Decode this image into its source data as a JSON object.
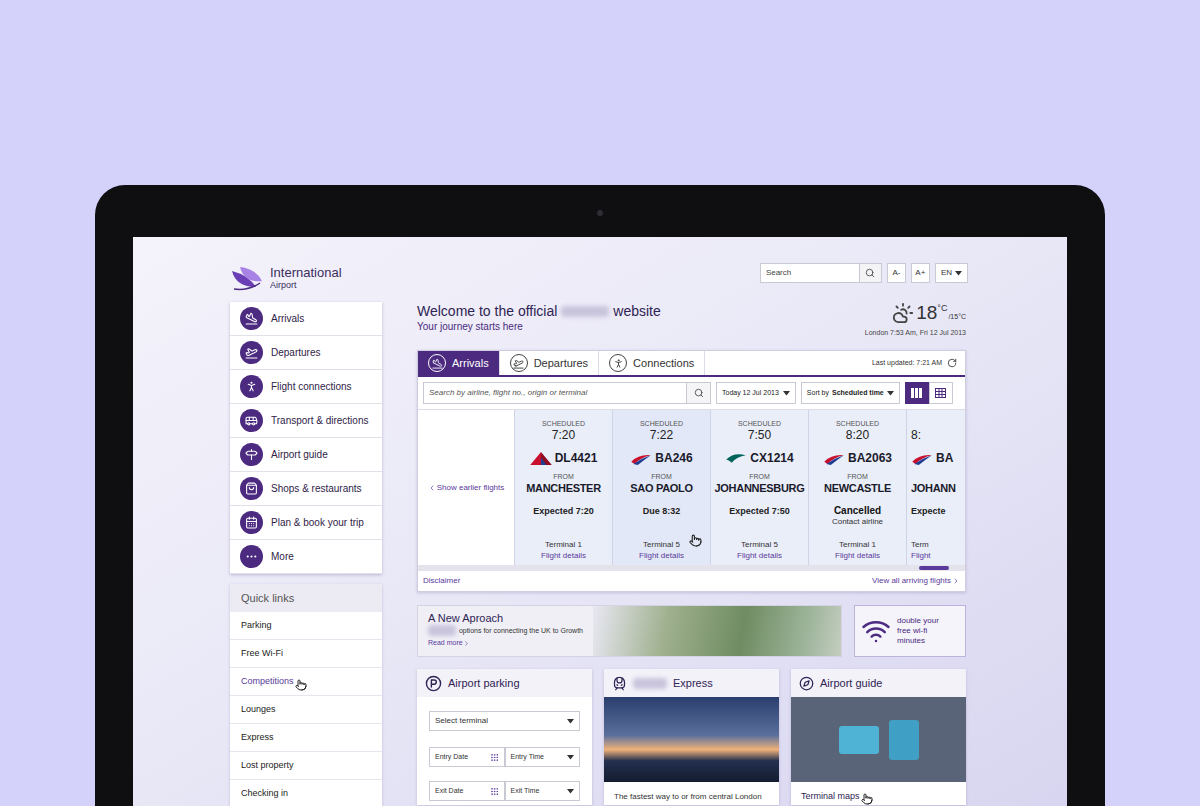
{
  "header": {
    "logo": {
      "title": "International",
      "subtitle": "Airport"
    },
    "search": {
      "placeholder": "Search"
    },
    "text_size_buttons": [
      "A-",
      "A+"
    ],
    "language": "EN"
  },
  "sidebar": {
    "items": [
      {
        "label": "Arrivals"
      },
      {
        "label": "Departures"
      },
      {
        "label": "Flight connections"
      },
      {
        "label": "Transport & directions"
      },
      {
        "label": "Airport guide"
      },
      {
        "label": "Shops & restaurants"
      },
      {
        "label": "Plan & book your trip"
      },
      {
        "label": "More"
      }
    ],
    "quick_links": {
      "title": "Quick links",
      "items": [
        {
          "label": "Parking",
          "hovered": false
        },
        {
          "label": "Free Wi-Fi",
          "hovered": false
        },
        {
          "label": "Competitions",
          "hovered": true
        },
        {
          "label": "Lounges",
          "hovered": false
        },
        {
          "label": "Express",
          "hovered": false
        },
        {
          "label": "Lost property",
          "hovered": false
        },
        {
          "label": "Checking in",
          "hovered": false
        }
      ]
    }
  },
  "welcome": {
    "before": "Welcome to the official",
    "after": "website",
    "tagline": "Your journey starts here"
  },
  "weather": {
    "temperature": "18",
    "unit": "°C",
    "low": "/15°C",
    "place_time": "London 7:53 Am, Fri 12 Jul 2013"
  },
  "flights": {
    "tabs": [
      {
        "label": "Arrivals",
        "selected": true
      },
      {
        "label": "Departures",
        "selected": false
      },
      {
        "label": "Connections",
        "selected": false
      }
    ],
    "last_updated": "Last updated: 7:21 AM",
    "search_placeholder": "Search by airline, flight no., origin or terminal",
    "date": "Today 12 Jul 2013",
    "sort_prefix": "Sort by",
    "sort_value": "Scheduled time",
    "views": [
      {
        "kind": "columns",
        "selected": true
      },
      {
        "kind": "table",
        "selected": false
      }
    ],
    "earlier": "Show earlier flights",
    "cards": [
      {
        "label": "SCHEDULED",
        "time": "7:20",
        "airline": "delta",
        "flight": "DL4421",
        "from_label": "FROM",
        "city": "MANCHESTER",
        "status": "Expected 7:20",
        "cancelled": false,
        "terminal": "Terminal 1",
        "details": "Flight details",
        "partial": false,
        "hovered": false
      },
      {
        "label": "SCHEDULED",
        "time": "7:22",
        "airline": "ba",
        "flight": "BA246",
        "from_label": "FROM",
        "city": "SAO PAOLO",
        "status": "Due 8:32",
        "cancelled": false,
        "terminal": "Terminal 5",
        "details": "Flight details",
        "partial": false,
        "hovered": true
      },
      {
        "label": "SCHEDULED",
        "time": "7:50",
        "airline": "cathay",
        "flight": "CX1214",
        "from_label": "FROM",
        "city": "JOHANNESBURG",
        "status": "Expected 7:50",
        "cancelled": false,
        "terminal": "Terminal 5",
        "details": "Flight details",
        "partial": false,
        "hovered": false
      },
      {
        "label": "SCHEDULED",
        "time": "8:20",
        "airline": "ba",
        "flight": "BA2063",
        "from_label": "FROM",
        "city": "NEWCASTLE",
        "status": "Cancelled",
        "note": "Contact airline",
        "cancelled": true,
        "terminal": "Terminal 1",
        "details": "Flight details",
        "partial": false,
        "hovered": false
      },
      {
        "time": "8:",
        "airline": "ba",
        "flight": "BA",
        "city": "JOHANN",
        "status": "Expecte",
        "cancelled": false,
        "terminal": "Term",
        "details": "Flight",
        "partial": true,
        "hovered": false
      }
    ],
    "scrollbar": {
      "level": 0.97
    },
    "disclaimer": "Disclaimer",
    "view_all": "View all arriving flights"
  },
  "promo": {
    "title": "A New Aproach",
    "subtitle": "options for connecting the UK to Growth",
    "link": "Read more"
  },
  "wifi": {
    "lines": [
      "double your",
      "free wi-fi",
      "minutes"
    ]
  },
  "parking": {
    "title": "Airport parking",
    "select": "Select terminal",
    "fields": [
      {
        "label": "Entry Date",
        "kind": "date"
      },
      {
        "label": "Entry Time",
        "kind": "time"
      },
      {
        "label": "Exit Date",
        "kind": "date"
      },
      {
        "label": "Exit Time",
        "kind": "time"
      }
    ]
  },
  "express": {
    "title": "Express",
    "caption": "The fastest way to or from central London"
  },
  "guide": {
    "title": "Airport guide",
    "link": "Terminal maps",
    "hovered": true
  }
}
